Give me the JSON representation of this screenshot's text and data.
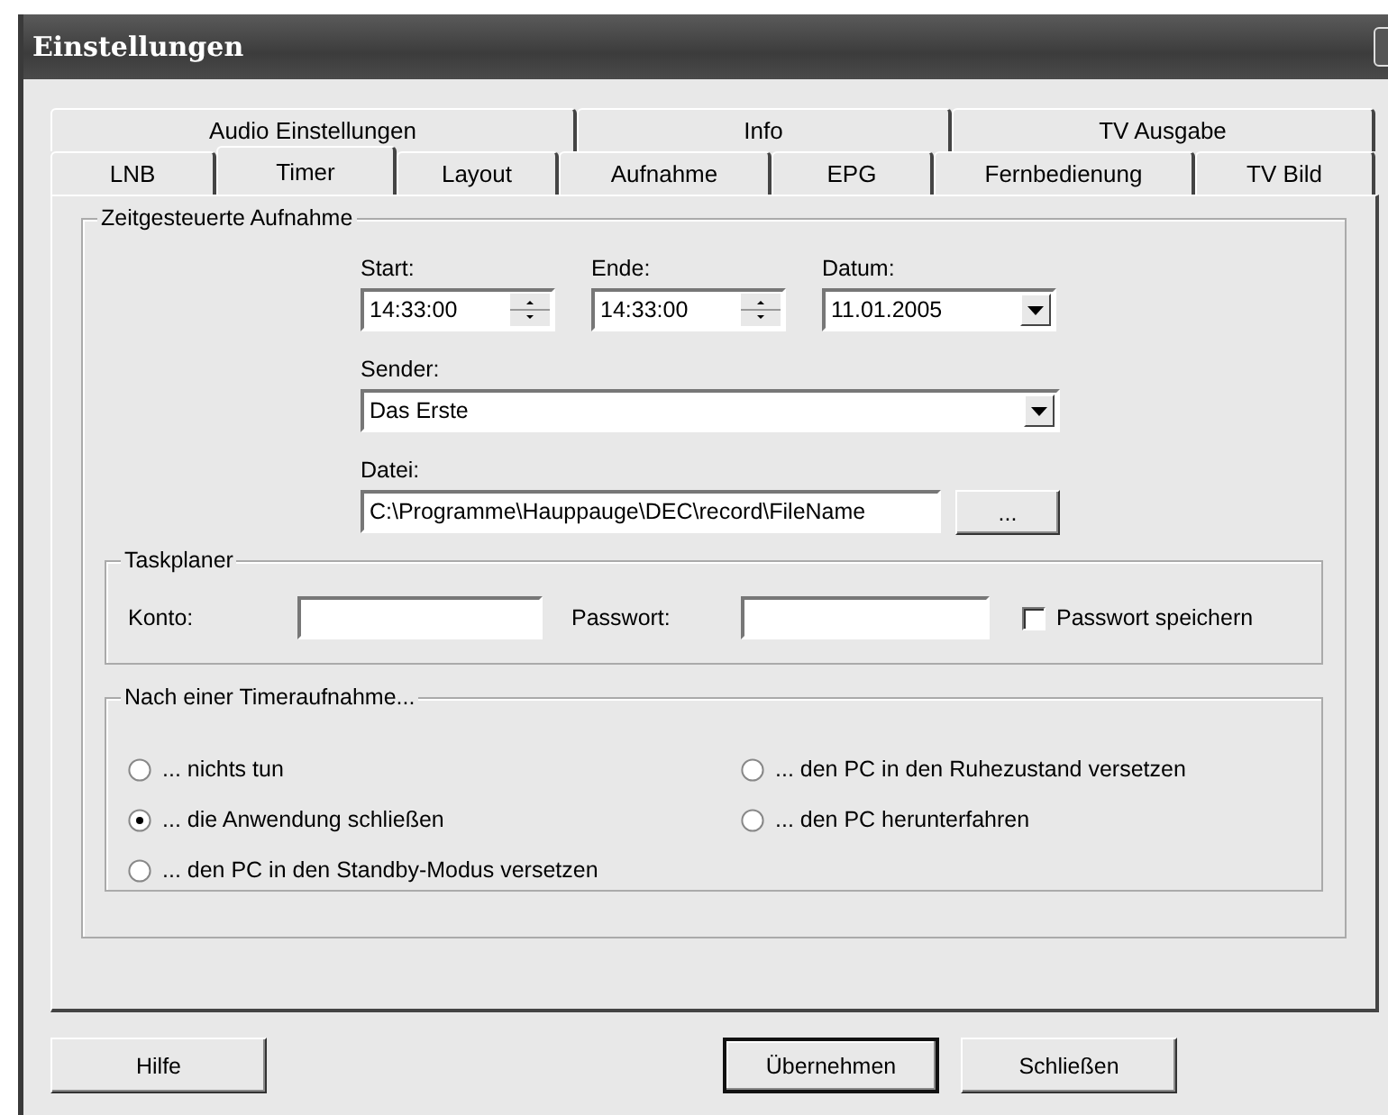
{
  "window": {
    "title": "Einstellungen"
  },
  "tab_rows": [
    [
      {
        "label": "Audio Einstellungen",
        "selected": false
      },
      {
        "label": "Info",
        "selected": false
      },
      {
        "label": "TV Ausgabe",
        "selected": false
      }
    ],
    [
      {
        "label": "LNB",
        "selected": false
      },
      {
        "label": "Timer",
        "selected": true
      },
      {
        "label": "Layout",
        "selected": false
      },
      {
        "label": "Aufnahme",
        "selected": false
      },
      {
        "label": "EPG",
        "selected": false
      },
      {
        "label": "Fernbedienung",
        "selected": false
      },
      {
        "label": "TV Bild",
        "selected": false
      }
    ]
  ],
  "recording": {
    "title": "Zeitgesteuerte Aufnahme",
    "start": {
      "label": "Start:",
      "value": "14:33:00"
    },
    "end": {
      "label": "Ende:",
      "value": "14:33:00"
    },
    "date": {
      "label": "Datum:",
      "value": "11.01.2005"
    },
    "channel": {
      "label": "Sender:",
      "value": "Das Erste"
    },
    "file": {
      "label": "Datei:",
      "value": "C:\\Programme\\Hauppauge\\DEC\\record\\FileName",
      "button": "..."
    }
  },
  "taskplaner": {
    "title": "Taskplaner",
    "account_label": "Konto:",
    "password_label": "Passwort:",
    "save_password": {
      "label": "Passwort speichern",
      "checked": false
    }
  },
  "after": {
    "title": "Nach einer Timeraufnahme...",
    "options": [
      {
        "label": "... nichts tun",
        "selected": false
      },
      {
        "label": "... den PC in den Ruhezustand versetzen",
        "selected": false
      },
      {
        "label": "... die Anwendung schließen",
        "selected": true
      },
      {
        "label": "... den PC herunterfahren",
        "selected": false
      },
      {
        "label": "... den PC in den Standby-Modus versetzen",
        "selected": false
      }
    ]
  },
  "buttons": [
    {
      "label": "Hilfe",
      "kind": "normal"
    },
    {
      "label": "Übernehmen",
      "kind": "default"
    },
    {
      "label": "Schließen",
      "kind": "normal"
    }
  ]
}
